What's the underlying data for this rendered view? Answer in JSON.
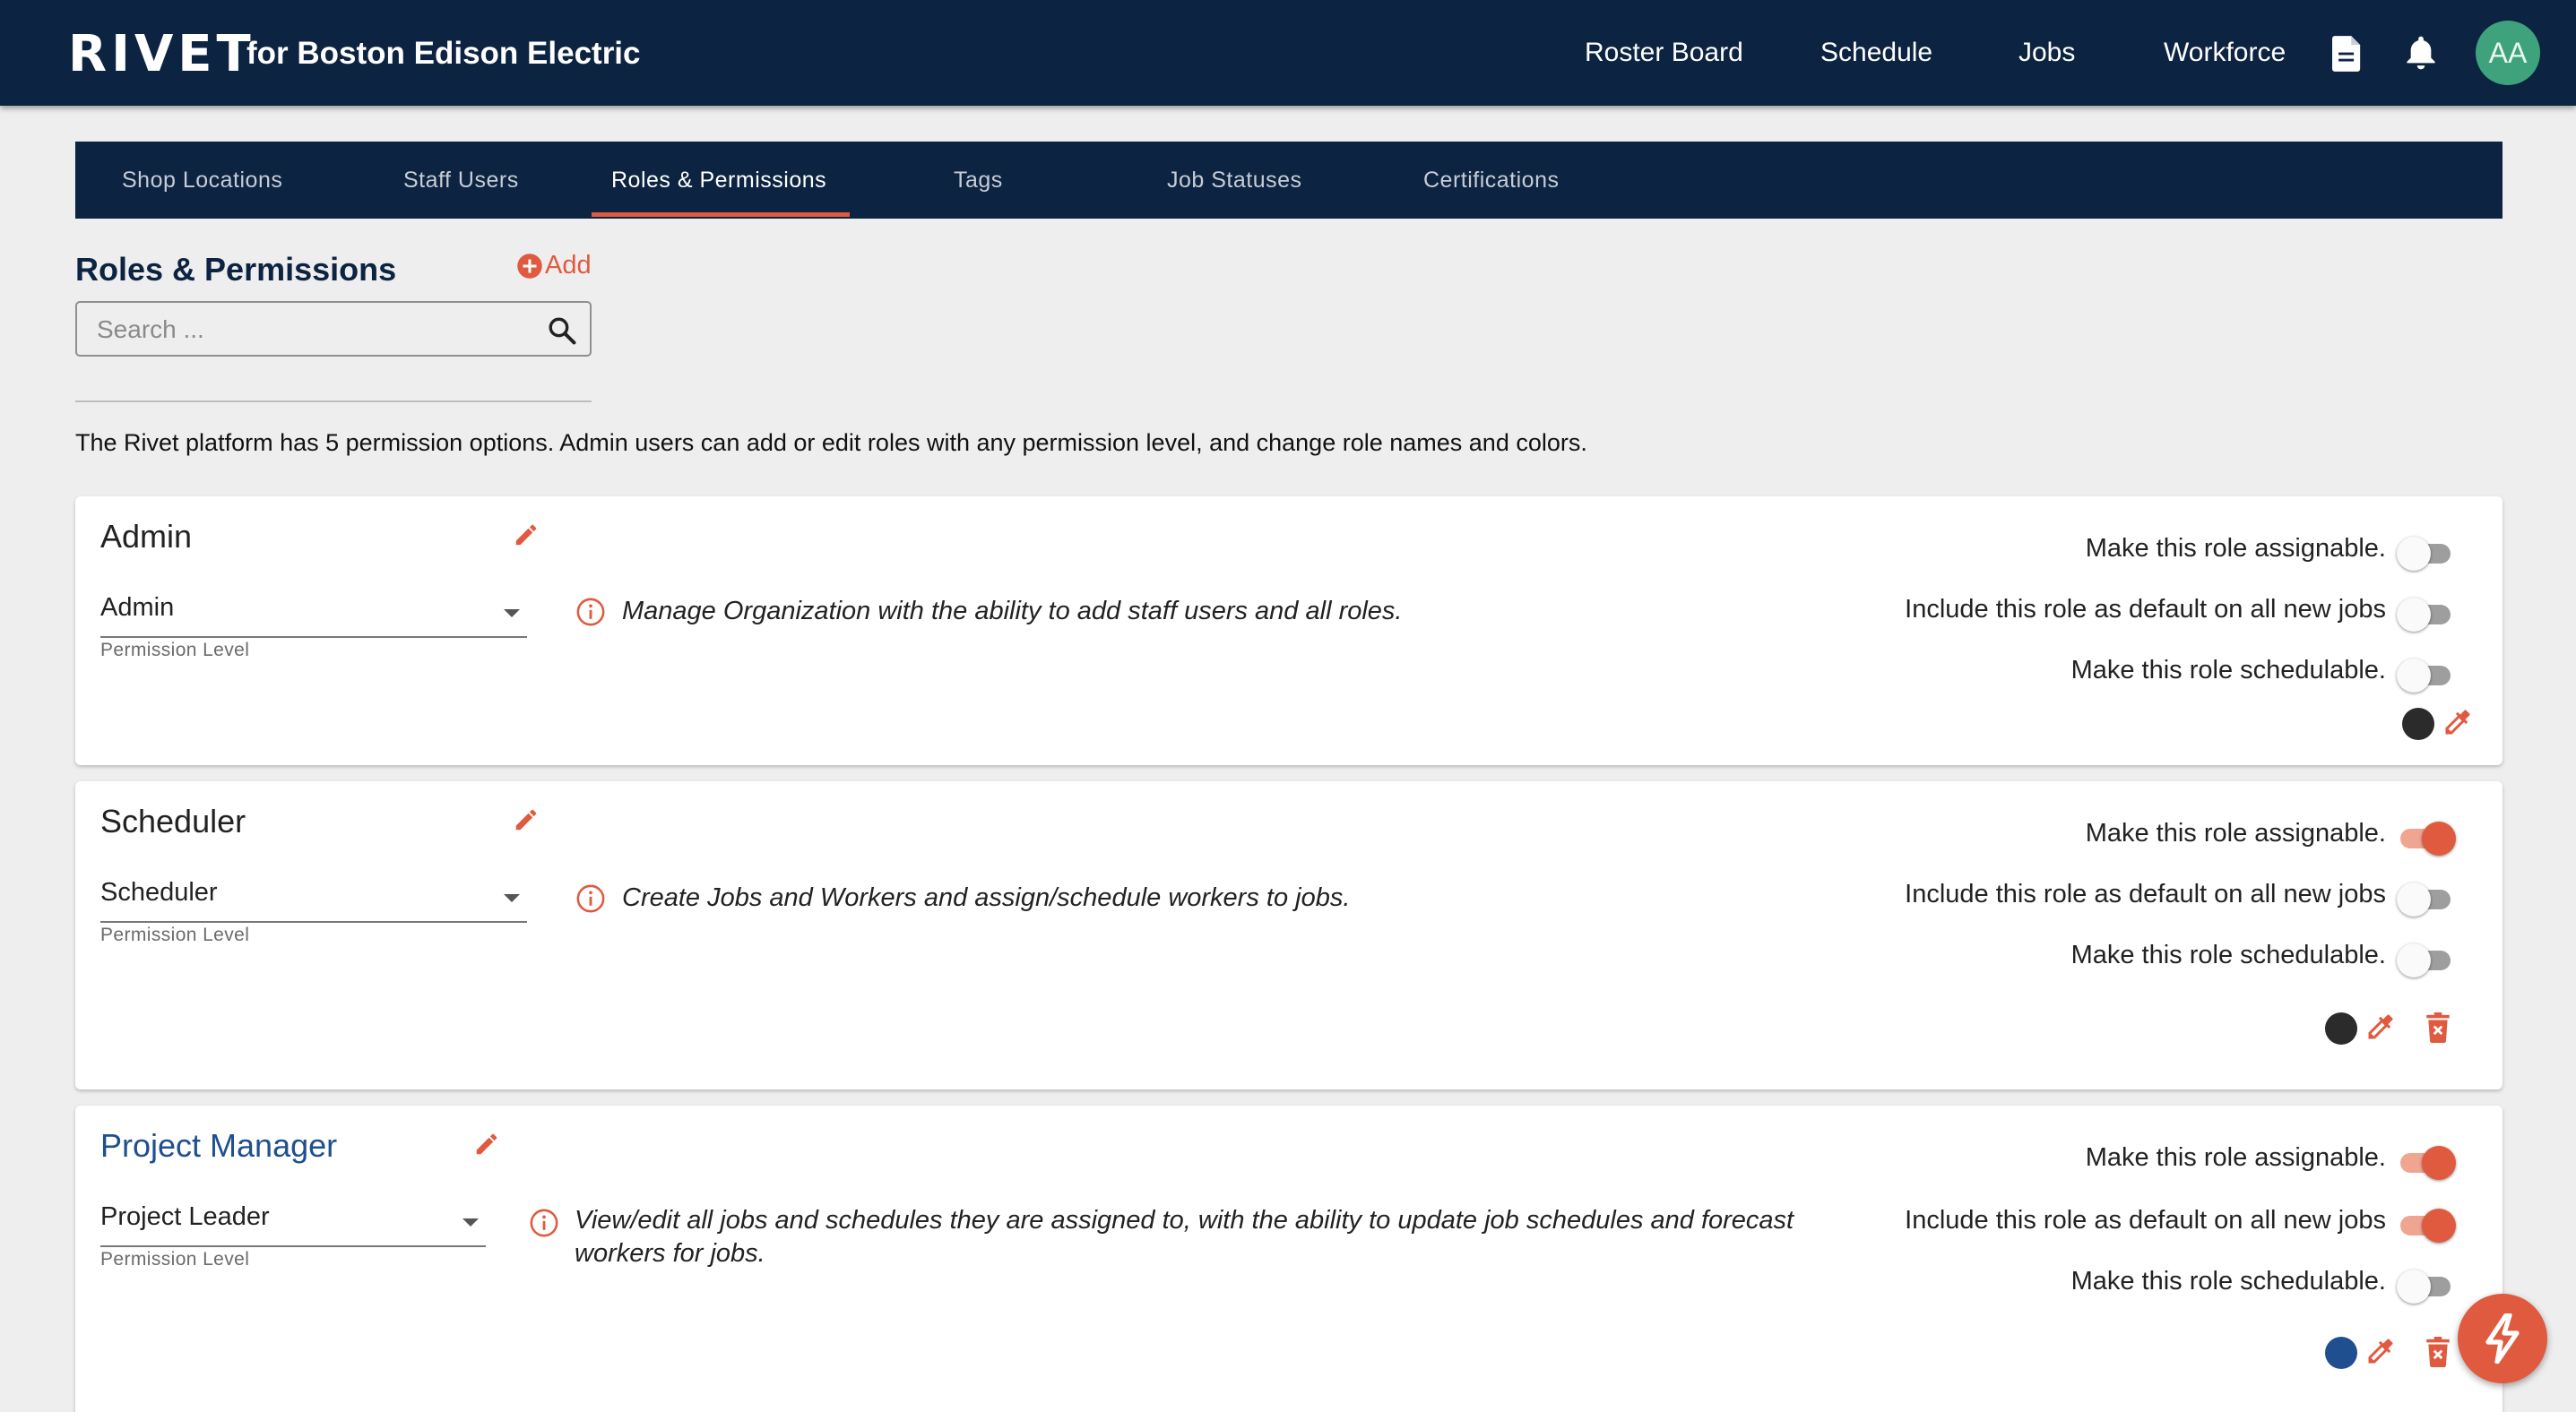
{
  "header": {
    "logo": "RIVET",
    "subtitle": "for Boston Edison Electric",
    "nav": [
      "Roster Board",
      "Schedule",
      "Jobs",
      "Workforce"
    ],
    "avatar_initials": "AA"
  },
  "tabs": [
    "Shop Locations",
    "Staff Users",
    "Roles & Permissions",
    "Tags",
    "Job Statuses",
    "Certifications"
  ],
  "active_tab": "Roles & Permissions",
  "section": {
    "title": "Roles & Permissions",
    "add_label": "Add",
    "search_placeholder": "Search ...",
    "intro": "The Rivet platform has 5 permission options. Admin users can add or edit roles with any permission level, and change role names and colors."
  },
  "option_labels": {
    "assignable": "Make this role assignable.",
    "default": "Include this role as default on all new jobs",
    "schedulable": "Make this role schedulable."
  },
  "permission_label": "Permission Level",
  "roles": [
    {
      "name": "Admin",
      "permission": "Admin",
      "description": "Manage Organization with the ability to add staff users and all roles.",
      "assignable": false,
      "default": false,
      "schedulable": false,
      "color": "#2b2b2b"
    },
    {
      "name": "Scheduler",
      "permission": "Scheduler",
      "description": "Create Jobs and Workers and assign/schedule workers to jobs.",
      "assignable": true,
      "default": false,
      "schedulable": false,
      "color": "#2b2b2b"
    },
    {
      "name": "Project Manager",
      "permission": "Project Leader",
      "description_line1": "View/edit all jobs and schedules they are assigned to, with the ability to update job schedules and forecast",
      "description_line2": "workers for jobs.",
      "assignable": true,
      "default": true,
      "schedulable": false,
      "color": "#1f4f8f"
    }
  ],
  "colors": {
    "navy": "#0c2341",
    "accent": "#e05a3f",
    "avatar": "#3ea37c"
  }
}
